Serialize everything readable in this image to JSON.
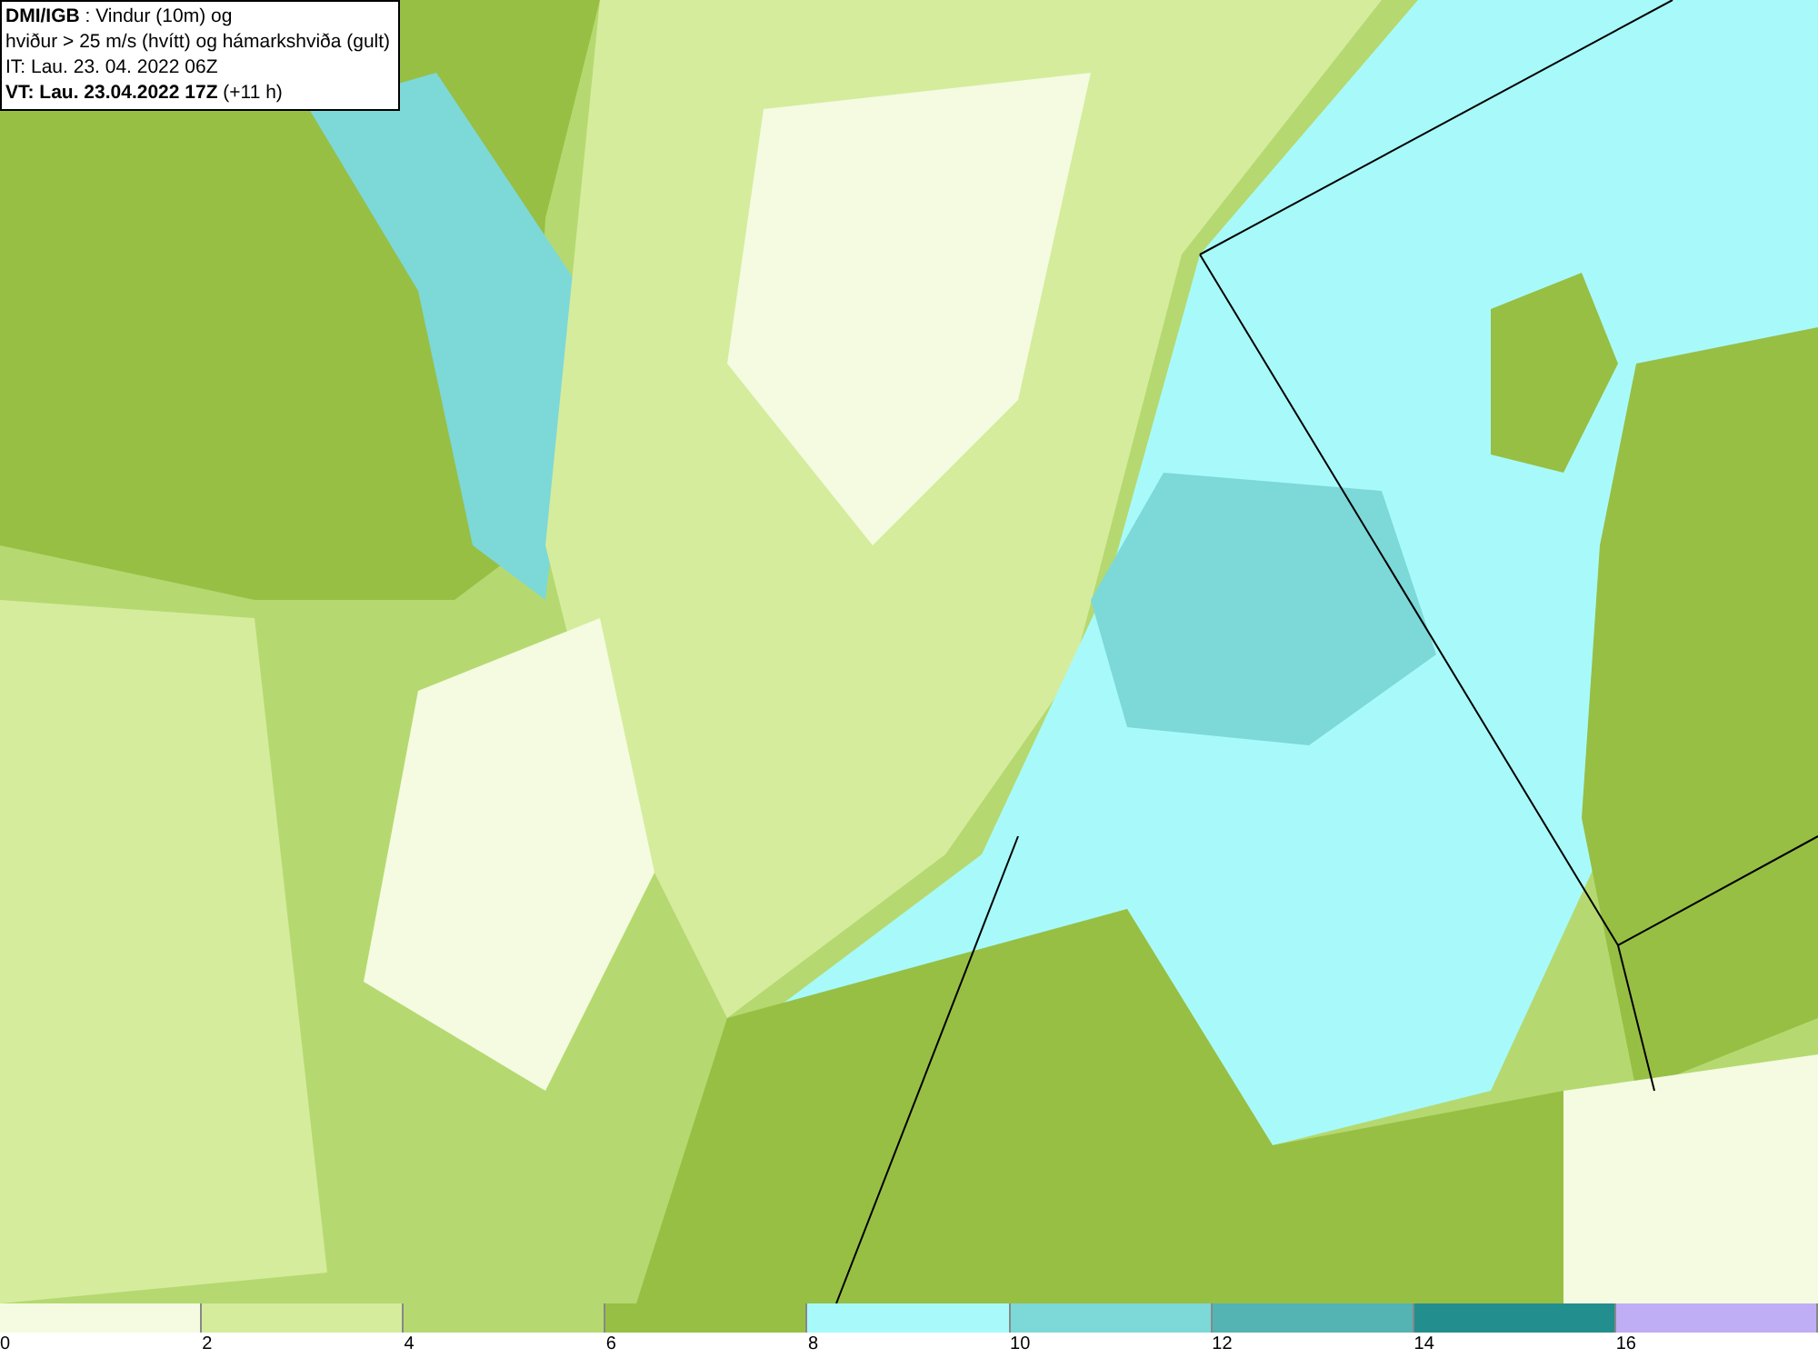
{
  "header": {
    "lines": [
      "**DMI/IGB** : Vindur (10m) og",
      "hviður > 25 m/s (hvítt) og hámarkshviða (gult)",
      "IT: Lau. 23. 04. 2022 06Z",
      "**VT: Lau. 23.04.2022 17Z** (+11 h)"
    ]
  },
  "legend": {
    "bins": [
      {
        "color": "#f4fbe0",
        "label": "0"
      },
      {
        "color": "#d5ec9d",
        "label": "2"
      },
      {
        "color": "#b5d970",
        "label": "4"
      },
      {
        "color": "#97bf44",
        "label": "6"
      },
      {
        "color": "#a8fafa",
        "label": "8"
      },
      {
        "color": "#7dd8d8",
        "label": "10"
      },
      {
        "color": "#54b3b3",
        "label": "12"
      },
      {
        "color": "#238e8e",
        "label": "14"
      },
      {
        "color": "#bfaef5",
        "label": "16"
      }
    ]
  }
}
